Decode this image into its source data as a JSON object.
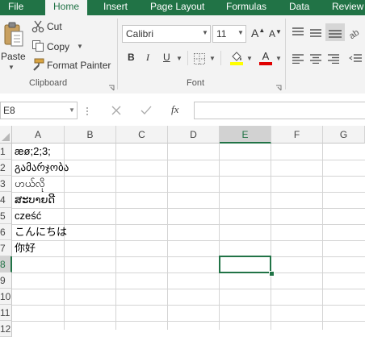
{
  "tabs": [
    "File",
    "Home",
    "Insert",
    "Page Layout",
    "Formulas",
    "Data",
    "Review"
  ],
  "active_tab": "Home",
  "clipboard": {
    "paste_label": "Paste",
    "cut_label": "Cut",
    "copy_label": "Copy",
    "format_painter_label": "Format Painter",
    "group_label": "Clipboard"
  },
  "font": {
    "name": "Calibri",
    "size": "11",
    "bold": "B",
    "italic": "I",
    "underline": "U",
    "font_color_glyph": "A",
    "grow_glyph": "A",
    "shrink_glyph": "A",
    "group_label": "Font",
    "highlight_color": "#ffff00",
    "font_color": "#e00000"
  },
  "formula_bar": {
    "name_box": "E8",
    "fx": "fx",
    "formula": ""
  },
  "grid": {
    "columns": [
      "A",
      "B",
      "C",
      "D",
      "E",
      "F",
      "G"
    ],
    "selected_column": "E",
    "rows": [
      "1",
      "2",
      "3",
      "4",
      "5",
      "6",
      "7",
      "8",
      "9",
      "10",
      "11",
      "12"
    ],
    "selected_row": "8",
    "cells_col_a": [
      "æø;2;3;",
      "გამარჯობა",
      "ဟယ်လို",
      "ສະບາຍດີ",
      "cześć",
      "こんにちは",
      "你好"
    ]
  },
  "colors": {
    "accent": "#217346",
    "ribbon_bg": "#f3f3f3"
  }
}
